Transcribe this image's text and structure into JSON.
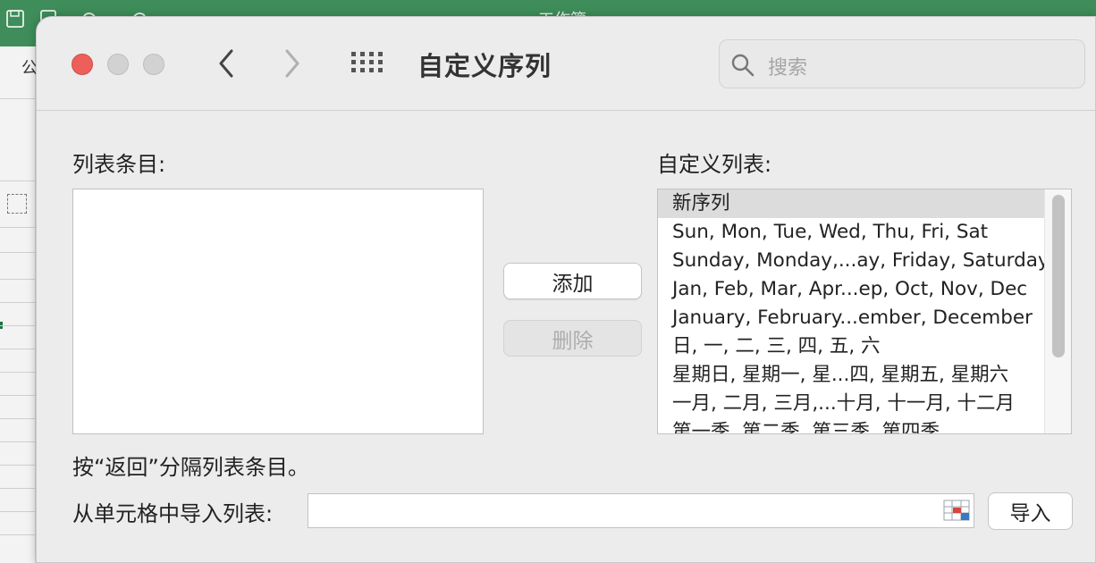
{
  "background": {
    "window_title": "工作簿",
    "ribbon_fragment": "公"
  },
  "dialog": {
    "title": "自定义序列",
    "search": {
      "placeholder": "搜索",
      "value": ""
    },
    "list_entries_label": "列表条目:",
    "custom_lists_label": "自定义列表:",
    "add_button": "添加",
    "delete_button": "删除",
    "custom_lists": [
      "新序列",
      "Sun, Mon, Tue, Wed, Thu, Fri, Sat",
      "Sunday, Monday,...ay, Friday, Saturday",
      "Jan, Feb, Mar, Apr...ep, Oct, Nov, Dec",
      "January, February...ember, December",
      "日, 一, 二, 三, 四, 五, 六",
      "星期日, 星期一, 星...四, 星期五, 星期六",
      "一月, 二月, 三月,...十月, 十一月, 十二月",
      "第一季, 第二季, 第三季, 第四季"
    ],
    "selected_index": 0,
    "hint": "按“返回”分隔列表条目。",
    "import_label": "从单元格中导入列表:",
    "import_value": "",
    "import_button": "导入"
  },
  "colors": {
    "excel_green": "#3e8d5a",
    "close_red": "#ec5f5a",
    "dialog_bg": "#ececec"
  }
}
